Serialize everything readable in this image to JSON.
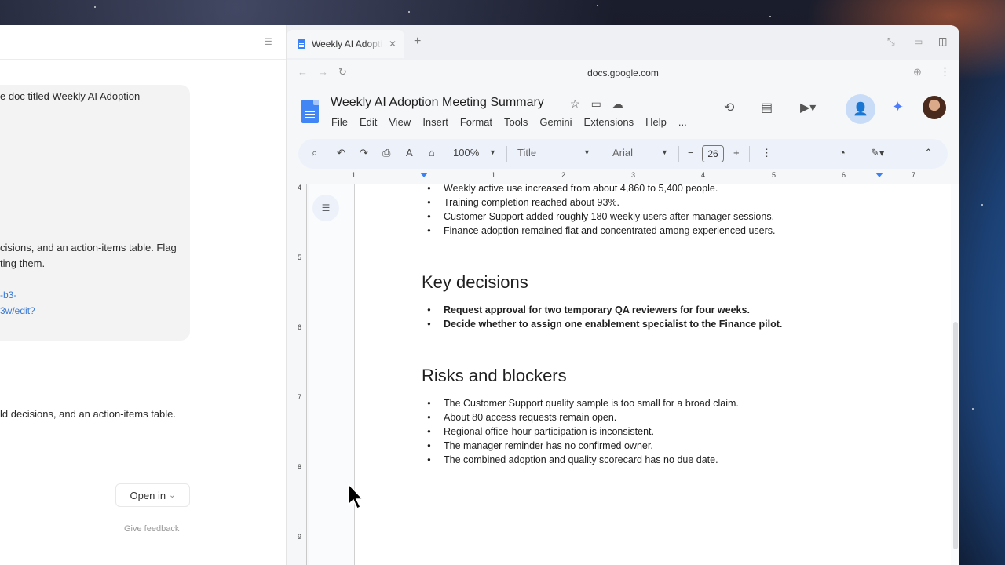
{
  "chat": {
    "lines": [
      "e doc titled Weekly AI Adoption",
      "cisions, and an action-items table. Flag",
      "ting them.",
      "ld decisions, and an action-items table."
    ],
    "links": [
      "-b3-",
      "3w/edit?"
    ],
    "open_in_label": "Open in",
    "feedback_label": "Give feedback"
  },
  "browser": {
    "tab_title": "Weekly AI Adoption Meeting Summary",
    "url": "docs.google.com"
  },
  "doc": {
    "title": "Weekly AI Adoption Meeting Summary",
    "menu": [
      "File",
      "Edit",
      "View",
      "Insert",
      "Format",
      "Tools",
      "Gemini",
      "Extensions",
      "Help",
      "..."
    ],
    "toolbar": {
      "zoom": "100%",
      "style": "Title",
      "font": "Arial",
      "font_size": "26"
    },
    "ruler_numbers": [
      "1",
      "1",
      "2",
      "3",
      "4",
      "5",
      "6",
      "7"
    ],
    "v_ruler_numbers": [
      "4",
      "5",
      "6",
      "7",
      "8",
      "9"
    ],
    "metrics_bullets": [
      "Weekly active use increased from about 4,860 to 5,400 people.",
      "Training completion reached about 93%.",
      "Customer Support added roughly 180 weekly users after manager sessions.",
      "Finance adoption remained flat and concentrated among experienced users."
    ],
    "key_decisions_heading": "Key decisions",
    "key_decisions": [
      "Request approval for two temporary QA reviewers for four weeks.",
      "Decide whether to assign one enablement specialist to the Finance pilot."
    ],
    "risks_heading": "Risks and blockers",
    "risks": [
      "The Customer Support quality sample is too small for a broad claim.",
      "About 80 access requests remain open.",
      "Regional office-hour participation is inconsistent.",
      "The manager reminder has no confirmed owner.",
      "The combined adoption and quality scorecard has no due date."
    ]
  },
  "colors": {
    "docs_blue": "#4285f4",
    "toolbar_bg": "#edf2fa",
    "link": "#3a7bd5"
  }
}
